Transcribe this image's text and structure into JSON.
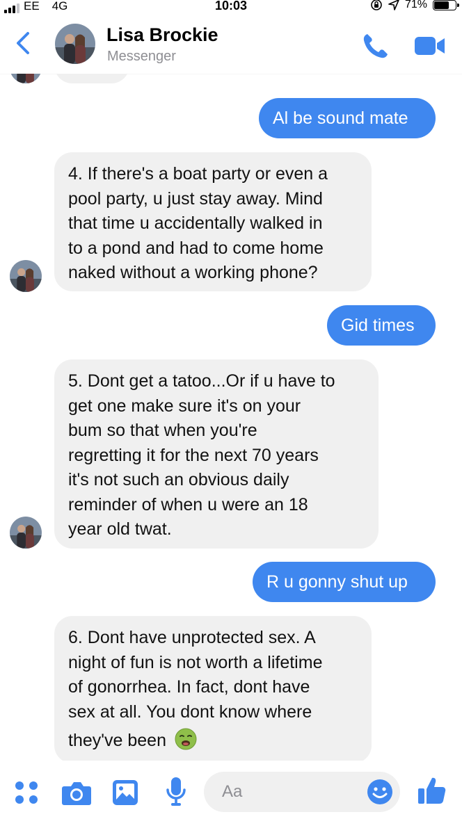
{
  "status_bar": {
    "carrier": "EE",
    "network": "4G",
    "time": "10:03",
    "battery": "71%",
    "battery_level": 0.71
  },
  "header": {
    "contact_name": "Lisa Brockie",
    "subtitle": "Messenger",
    "back_icon": "chevron-left-icon",
    "call_icon": "phone-icon",
    "video_icon": "video-camera-icon"
  },
  "messages": [
    {
      "direction": "out",
      "text": "Al be sound mate"
    },
    {
      "direction": "in",
      "lines": [
        "4. If there's a boat party or even a",
        "pool party, u just stay away. Mind",
        "that time u accidentally walked in",
        "to a pond and had to come home",
        "naked without a working phone?"
      ]
    },
    {
      "direction": "out",
      "text": "Gid times"
    },
    {
      "direction": "in",
      "lines": [
        "5. Dont get a tatoo...Or if u have to",
        "get one make sure it's on your",
        "bum so that when you're",
        "regretting it for the next 70 years",
        "it's not such an obvious daily",
        "reminder of when u were an 18",
        "year old twat."
      ]
    },
    {
      "direction": "out",
      "text": "R u gonny shut up"
    },
    {
      "direction": "in",
      "lines": [
        "6. Dont have unprotected sex. A",
        "night of fun is not worth a lifetime",
        "of gonorrhea. In fact, dont have",
        "sex at all. You dont know where",
        "they've been"
      ],
      "trailing_emoji": "nauseated-face-emoji"
    }
  ],
  "composer": {
    "placeholder": "Aa",
    "icons": [
      "menu-dots-icon",
      "camera-icon",
      "image-icon",
      "microphone-icon",
      "emoji-icon",
      "thumbs-up-icon"
    ]
  },
  "colors": {
    "accent": "#3f87ef",
    "incoming_bubble": "#f0f0f0",
    "subtitle_gray": "#8e8e93"
  }
}
